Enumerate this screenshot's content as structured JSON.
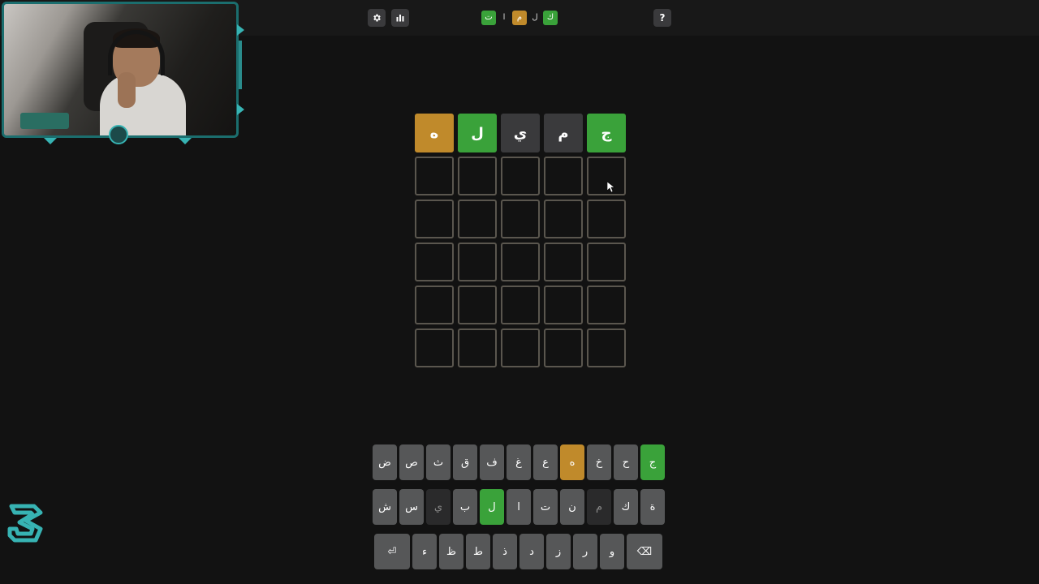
{
  "header": {
    "icons": {
      "settings": "gear-icon",
      "stats": "bar-chart-icon",
      "help": "help-icon"
    },
    "help_label": "?",
    "title_letters": [
      {
        "char": "ت",
        "state": "green"
      },
      {
        "char": "ا",
        "state": "plain"
      },
      {
        "char": "م",
        "state": "yellow"
      },
      {
        "char": "ل",
        "state": "plain"
      },
      {
        "char": "ك",
        "state": "green"
      }
    ]
  },
  "colors": {
    "background": "#121212",
    "correct": "#3aa23a",
    "present": "#c08a2b",
    "absent": "#3a3a3c",
    "key": "#565758",
    "accent": "#37b3b3"
  },
  "board": {
    "rows": [
      [
        {
          "letter": "ه",
          "state": "yellow"
        },
        {
          "letter": "ل",
          "state": "green"
        },
        {
          "letter": "ي",
          "state": "gray"
        },
        {
          "letter": "م",
          "state": "gray"
        },
        {
          "letter": "ج",
          "state": "green"
        }
      ],
      [
        {
          "letter": ""
        },
        {
          "letter": ""
        },
        {
          "letter": ""
        },
        {
          "letter": ""
        },
        {
          "letter": ""
        }
      ],
      [
        {
          "letter": ""
        },
        {
          "letter": ""
        },
        {
          "letter": ""
        },
        {
          "letter": ""
        },
        {
          "letter": ""
        }
      ],
      [
        {
          "letter": ""
        },
        {
          "letter": ""
        },
        {
          "letter": ""
        },
        {
          "letter": ""
        },
        {
          "letter": ""
        }
      ],
      [
        {
          "letter": ""
        },
        {
          "letter": ""
        },
        {
          "letter": ""
        },
        {
          "letter": ""
        },
        {
          "letter": ""
        }
      ],
      [
        {
          "letter": ""
        },
        {
          "letter": ""
        },
        {
          "letter": ""
        },
        {
          "letter": ""
        },
        {
          "letter": ""
        }
      ]
    ]
  },
  "keyboard": {
    "rows": [
      [
        {
          "label": "ض"
        },
        {
          "label": "ص"
        },
        {
          "label": "ث"
        },
        {
          "label": "ق"
        },
        {
          "label": "ف"
        },
        {
          "label": "غ"
        },
        {
          "label": "ع"
        },
        {
          "label": "ه",
          "state": "yellow"
        },
        {
          "label": "خ"
        },
        {
          "label": "ح"
        },
        {
          "label": "ج",
          "state": "green"
        }
      ],
      [
        {
          "label": "ش"
        },
        {
          "label": "س"
        },
        {
          "label": "ي",
          "state": "absent"
        },
        {
          "label": "ب"
        },
        {
          "label": "ل",
          "state": "green"
        },
        {
          "label": "ا"
        },
        {
          "label": "ت"
        },
        {
          "label": "ن"
        },
        {
          "label": "م",
          "state": "absent"
        },
        {
          "label": "ك"
        },
        {
          "label": "ة"
        }
      ],
      [
        {
          "label": "⏎",
          "wide": true,
          "name": "enter-key"
        },
        {
          "label": "ء"
        },
        {
          "label": "ظ"
        },
        {
          "label": "ط"
        },
        {
          "label": "ذ"
        },
        {
          "label": "د"
        },
        {
          "label": "ز"
        },
        {
          "label": "ر"
        },
        {
          "label": "و"
        },
        {
          "label": "⌫",
          "wide": true,
          "name": "backspace-key"
        }
      ]
    ]
  }
}
